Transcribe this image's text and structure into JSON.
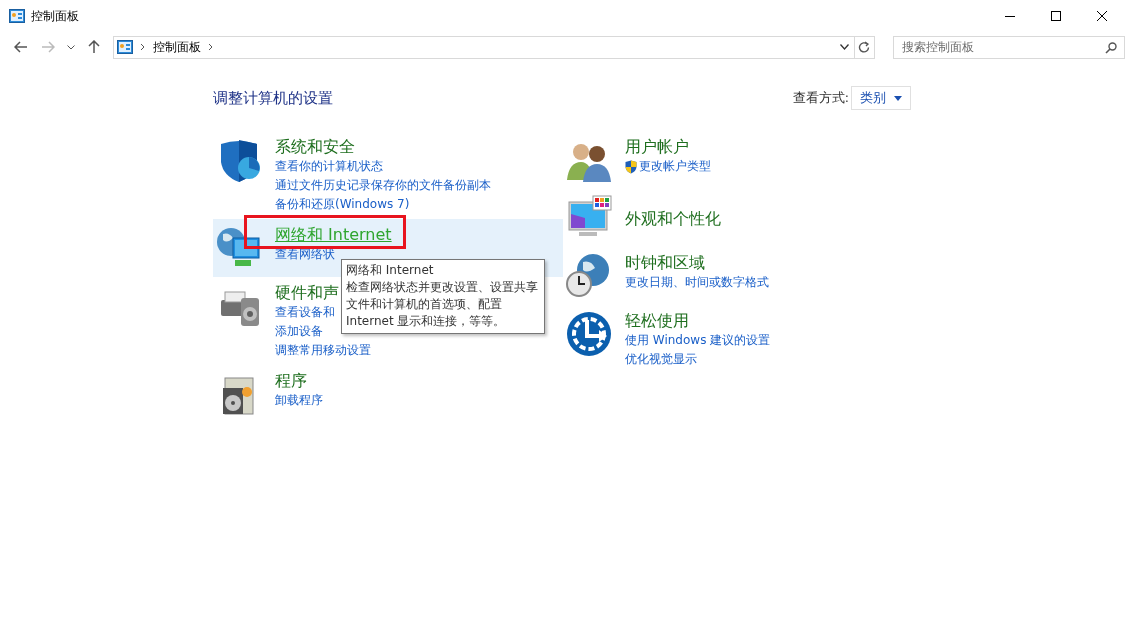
{
  "window": {
    "title": "控制面板"
  },
  "address_bar": {
    "crumbs": [
      "控制面板"
    ]
  },
  "search": {
    "placeholder": "搜索控制面板"
  },
  "heading": "调整计算机的设置",
  "view_by": {
    "label": "查看方式:",
    "value": "类别"
  },
  "left_categories": [
    {
      "kind": "shield",
      "title": "系统和安全",
      "hovered": false,
      "links": [
        {
          "text": "查看你的计算机状态",
          "shield": false
        },
        {
          "text": "通过文件历史记录保存你的文件备份副本",
          "shield": false
        },
        {
          "text": "备份和还原(Windows 7)",
          "shield": false
        }
      ]
    },
    {
      "kind": "network",
      "title": "网络和 Internet",
      "hovered": true,
      "links": [
        {
          "text": "查看网络状",
          "shield": false
        }
      ]
    },
    {
      "kind": "hardware",
      "title": "硬件和声",
      "hovered": false,
      "links": [
        {
          "text": "查看设备和",
          "shield": false
        },
        {
          "text": "添加设备",
          "shield": false
        },
        {
          "text": "调整常用移动设置",
          "shield": false
        }
      ]
    },
    {
      "kind": "programs",
      "title": "程序",
      "hovered": false,
      "links": [
        {
          "text": "卸载程序",
          "shield": false
        }
      ]
    }
  ],
  "right_categories": [
    {
      "kind": "users",
      "title": "用户帐户",
      "hovered": false,
      "links": [
        {
          "text": "更改帐户类型",
          "shield": true
        }
      ]
    },
    {
      "kind": "appearance",
      "title": "外观和个性化",
      "hovered": false
    },
    {
      "kind": "clock",
      "title": "时钟和区域",
      "hovered": false,
      "links": [
        {
          "text": "更改日期、时间或数字格式",
          "shield": false
        }
      ]
    },
    {
      "kind": "ease",
      "title": "轻松使用",
      "hovered": false,
      "links": [
        {
          "text": "使用 Windows 建议的设置",
          "shield": false
        },
        {
          "text": "优化视觉显示",
          "shield": false
        }
      ]
    }
  ],
  "tooltip": {
    "title": "网络和 Internet",
    "lines": [
      "检查网络状态并更改设置、设置共享",
      "文件和计算机的首选项、配置",
      "Internet 显示和连接，等等。"
    ]
  }
}
